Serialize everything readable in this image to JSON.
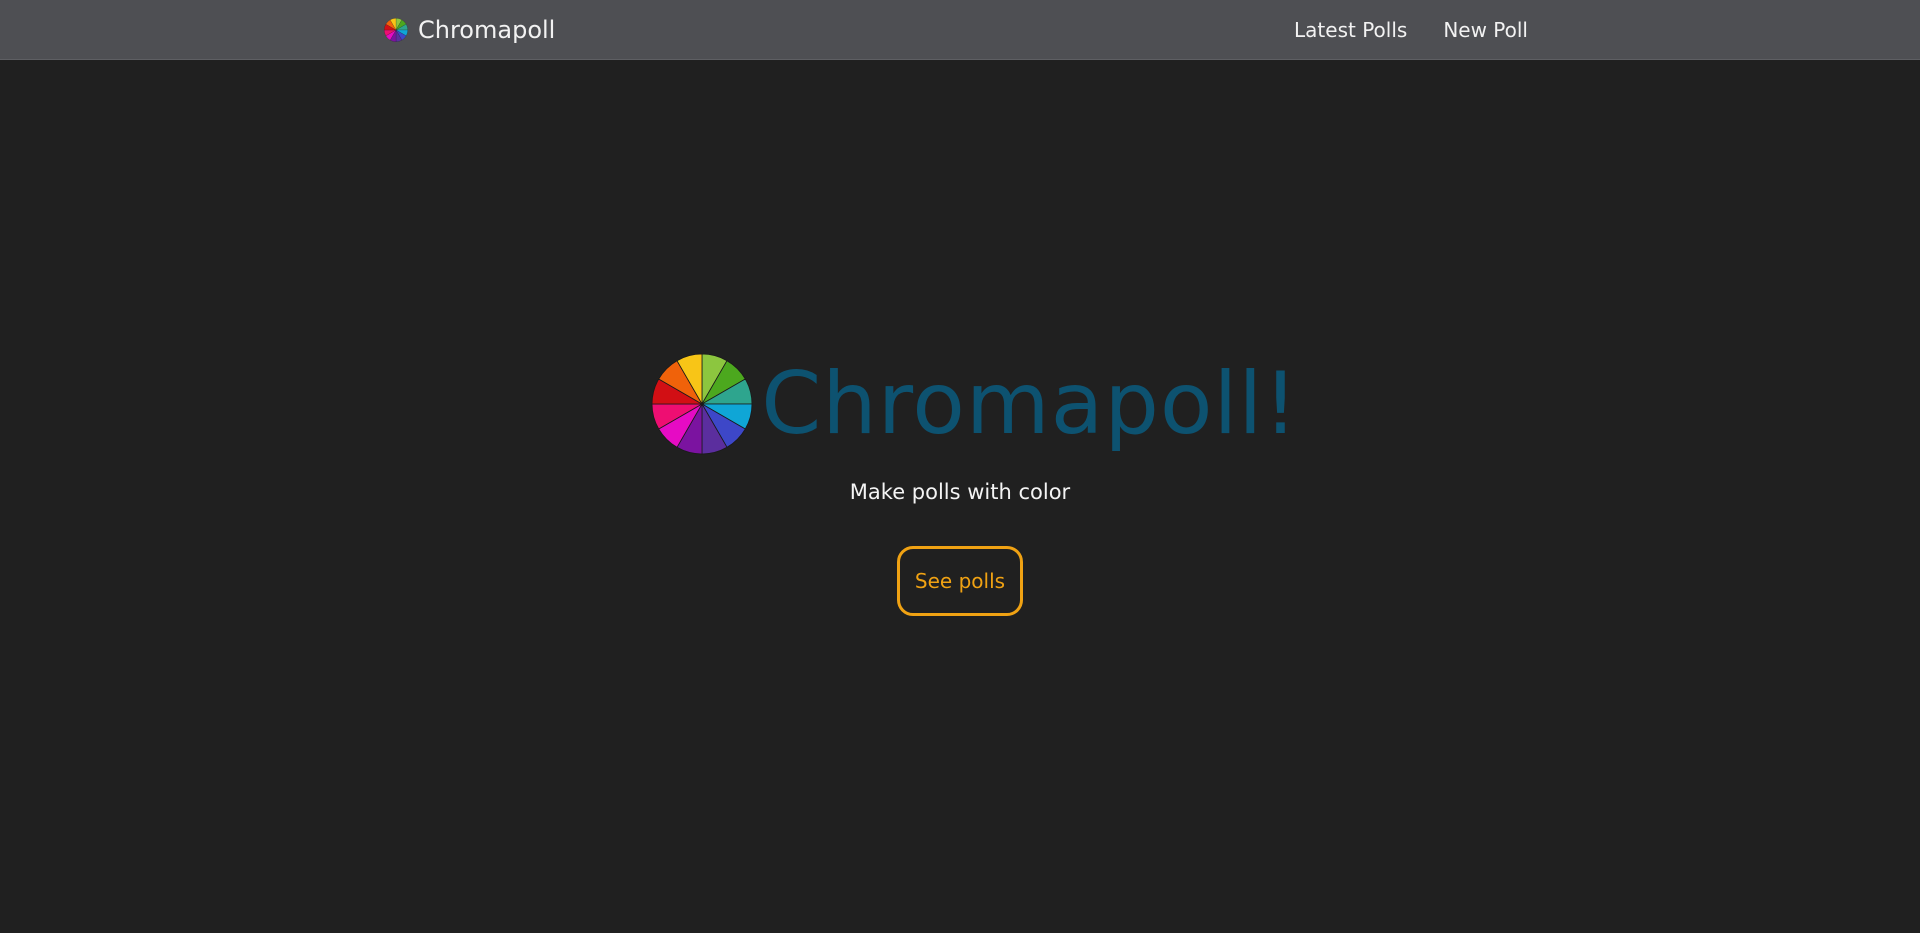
{
  "navbar": {
    "brand_label": "Chromapoll",
    "brand_icon": "color-wheel-icon",
    "links": [
      {
        "label": "Latest Polls"
      },
      {
        "label": "New Poll"
      }
    ]
  },
  "hero": {
    "title": "Chromapoll!",
    "logo_icon": "color-wheel-icon",
    "tagline": "Make polls with color",
    "cta_label": "See polls"
  },
  "colors": {
    "background": "#202020",
    "navbar": "#4e4f53",
    "title": "#0d5270",
    "accent": "#f0a213",
    "wheel": [
      "#8cc63f",
      "#4ca81e",
      "#2ea58e",
      "#0fa6d6",
      "#3d47c8",
      "#5b2e9e",
      "#7b13a0",
      "#e60bc4",
      "#ee0e72",
      "#d20f14",
      "#f0620a",
      "#f8c517"
    ]
  }
}
